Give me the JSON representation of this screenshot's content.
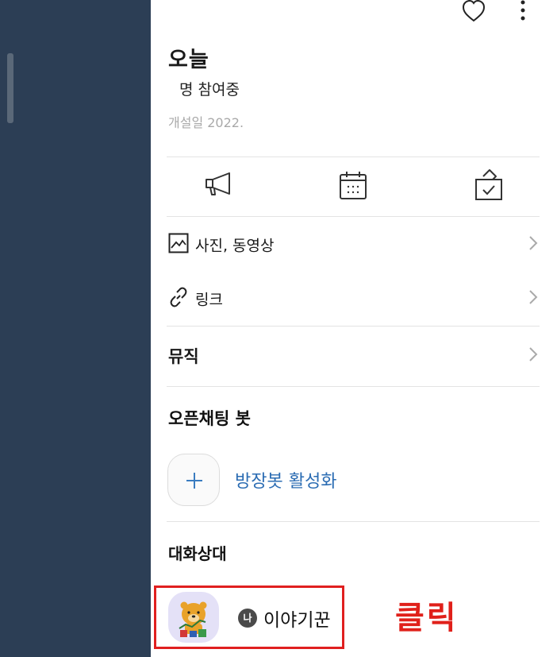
{
  "room": {
    "title": "오늘",
    "members": "명 참여중",
    "opened": "개설일 2022."
  },
  "header_icons": [
    "heart-icon",
    "more-vert-icon"
  ],
  "actions": [
    {
      "icon": "megaphone-icon"
    },
    {
      "icon": "calendar-icon"
    },
    {
      "icon": "vote-box-icon"
    }
  ],
  "menu": {
    "media_label": "사진, 동영상",
    "link_label": "링크",
    "music_label": "뮤직"
  },
  "bot": {
    "section_title": "오픈채팅 봇",
    "activate_label": "방장봇 활성화"
  },
  "participants": {
    "section_title": "대화상대",
    "me_badge": "나",
    "me_name": "이야기꾼"
  },
  "annotation": {
    "text": "클릭",
    "color": "#e0201a"
  },
  "colors": {
    "sidebar": "#2c3e55",
    "link_blue": "#2b6cb3",
    "highlight": "#e01f1f"
  }
}
